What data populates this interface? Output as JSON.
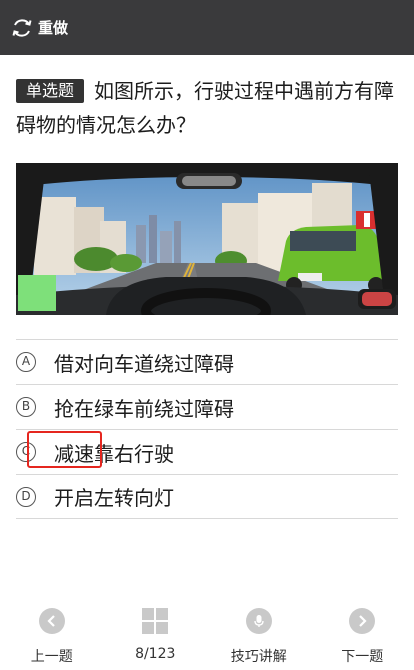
{
  "header": {
    "redo_label": "重做",
    "redo_icon": "refresh-icon",
    "background": "#3a3a3c"
  },
  "question": {
    "type_label": "单选题",
    "text": "如图所示，行驶过程中遇前方有障碍物的情况怎么办？"
  },
  "options": [
    {
      "letter": "A",
      "text": "借对向车道绕过障碍"
    },
    {
      "letter": "B",
      "text": "抢在绿车前绕过障碍"
    },
    {
      "letter": "C",
      "text": "减速靠右行驶"
    },
    {
      "letter": "D",
      "text": "开启左转向灯"
    }
  ],
  "highlight": {
    "color": "#e5261f",
    "target": "减速"
  },
  "bottom_nav": {
    "prev_label": "上一题",
    "progress": "8/123",
    "tips_label": "技巧讲解",
    "next_label": "下一题"
  }
}
